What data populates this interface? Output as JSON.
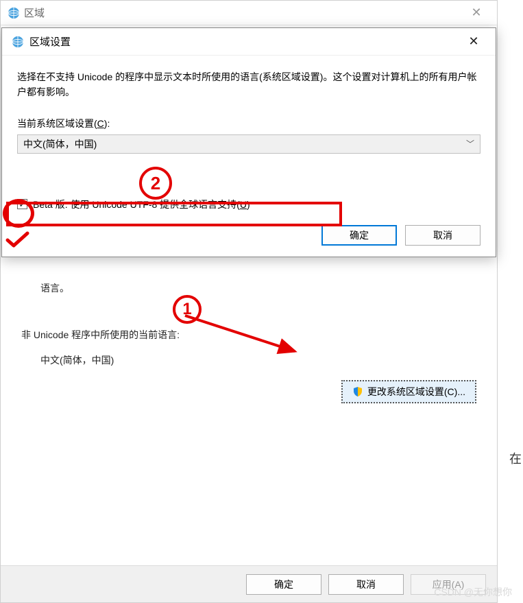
{
  "outer": {
    "title": "区域",
    "close": "✕",
    "lang_trunc": "语言。",
    "section_label": "非 Unicode 程序中所使用的当前语言:",
    "locale_value": "中文(简体，中国)",
    "change_btn": "更改系统区域设置(C)...",
    "ok": "确定",
    "cancel": "取消",
    "apply": "应用(A)"
  },
  "inner": {
    "title": "区域设置",
    "close": "✕",
    "desc": "选择在不支持 Unicode 的程序中显示文本时所使用的语言(系统区域设置)。这个设置对计算机上的所有用户帐户都有影响。",
    "field_label_pre": "当前系统区域设置(",
    "field_label_key": "C",
    "field_label_post": "):",
    "combo_value": "中文(简体，中国)",
    "checkbox_mark": "✓",
    "checkbox_label_pre": "Beta 版: 使用 Unicode UTF-8 提供全球语言支持(",
    "checkbox_label_key": "U",
    "checkbox_label_post": ")",
    "ok": "确定",
    "cancel": "取消"
  },
  "anno": {
    "num1": "1",
    "num2": "2"
  },
  "watermark": "CSDN @无你想你",
  "side_char": "在"
}
